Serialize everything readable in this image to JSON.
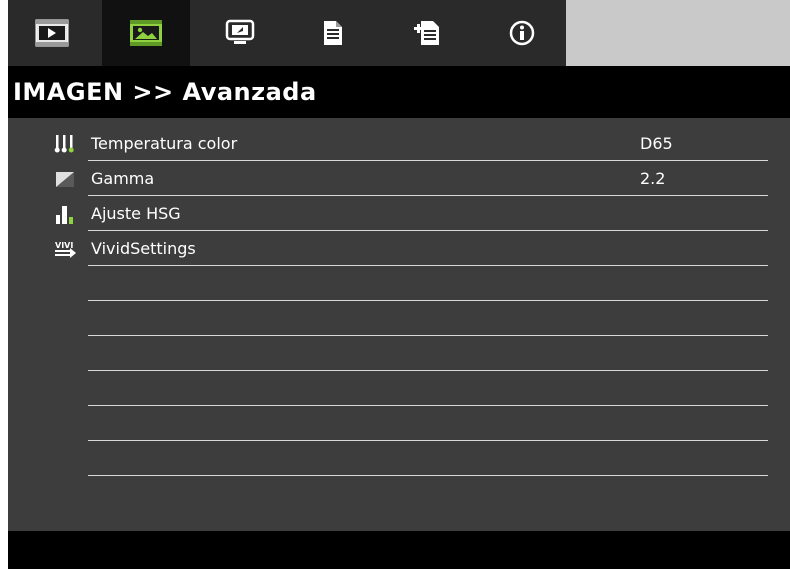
{
  "tabs": [
    {
      "name": "image-tab",
      "icon": "display-icon",
      "active": false
    },
    {
      "name": "image-settings-tab",
      "icon": "picture-icon",
      "active": true
    },
    {
      "name": "display-tab",
      "icon": "screen-icon",
      "active": false
    },
    {
      "name": "setup-basic-tab",
      "icon": "document-icon",
      "active": false
    },
    {
      "name": "setup-advanced-tab",
      "icon": "document-plus-icon",
      "active": false
    },
    {
      "name": "info-tab",
      "icon": "info-icon",
      "active": false
    }
  ],
  "header": {
    "title": "IMAGEN >> Avanzada"
  },
  "menu": {
    "items": [
      {
        "label": "Temperatura color",
        "value": "D65",
        "icon": "color-temperature-icon"
      },
      {
        "label": "Gamma",
        "value": "2.2",
        "icon": "gamma-icon"
      },
      {
        "label": "Ajuste HSG",
        "value": "",
        "icon": "hsg-bars-icon"
      },
      {
        "label": "VividSettings",
        "value": "",
        "icon": "vivid-settings-icon"
      }
    ],
    "empty_rows": 6
  },
  "colors": {
    "background": "#3d3d3d",
    "tab_bar": "#2a2a2a",
    "active_tab": "#111111",
    "active_icon": "#8fd13f",
    "title_bar": "#000000",
    "divider": "#d8d8d8",
    "text": "#ffffff"
  }
}
